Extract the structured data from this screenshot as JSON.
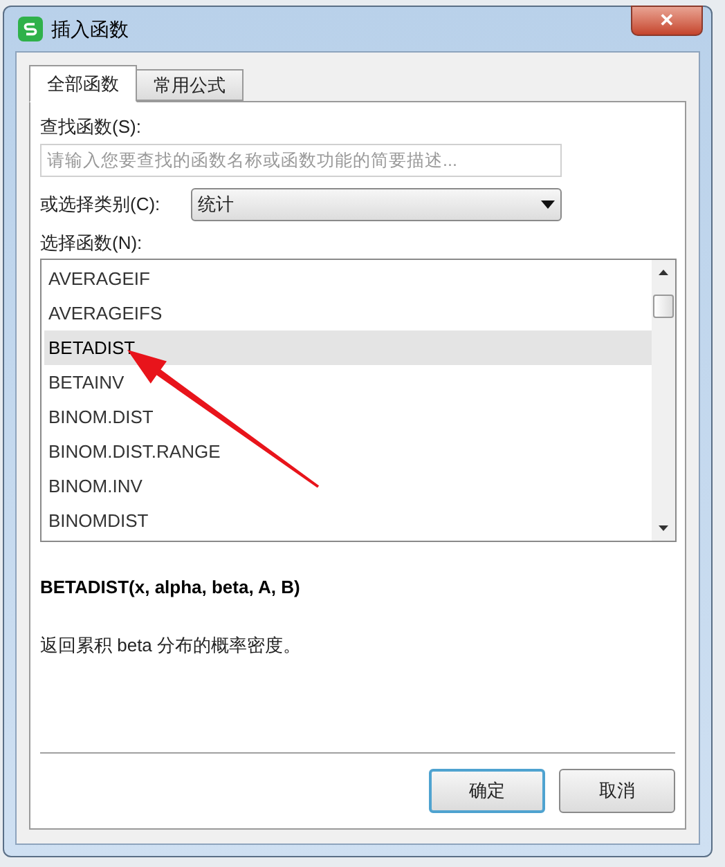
{
  "window": {
    "title": "插入函数",
    "close": "✕"
  },
  "tabs": [
    {
      "label": "全部函数",
      "selected": true
    },
    {
      "label": "常用公式",
      "selected": false
    }
  ],
  "search": {
    "label": "查找函数(S):",
    "placeholder": "请输入您要查找的函数名称或函数功能的简要描述..."
  },
  "category": {
    "label": "或选择类别(C):",
    "value": "统计"
  },
  "function_list": {
    "label": "选择函数(N):",
    "items": [
      {
        "name": "AVERAGEIF",
        "selected": false
      },
      {
        "name": "AVERAGEIFS",
        "selected": false
      },
      {
        "name": "BETADIST",
        "selected": true
      },
      {
        "name": "BETAINV",
        "selected": false
      },
      {
        "name": "BINOM.DIST",
        "selected": false
      },
      {
        "name": "BINOM.DIST.RANGE",
        "selected": false
      },
      {
        "name": "BINOM.INV",
        "selected": false
      },
      {
        "name": "BINOMDIST",
        "selected": false
      }
    ]
  },
  "signature": "BETADIST(x, alpha, beta, A, B)",
  "description": "返回累积 beta 分布的概率密度。",
  "buttons": [
    {
      "label": "确定",
      "kind": "default"
    },
    {
      "label": "取消",
      "kind": "normal"
    }
  ]
}
